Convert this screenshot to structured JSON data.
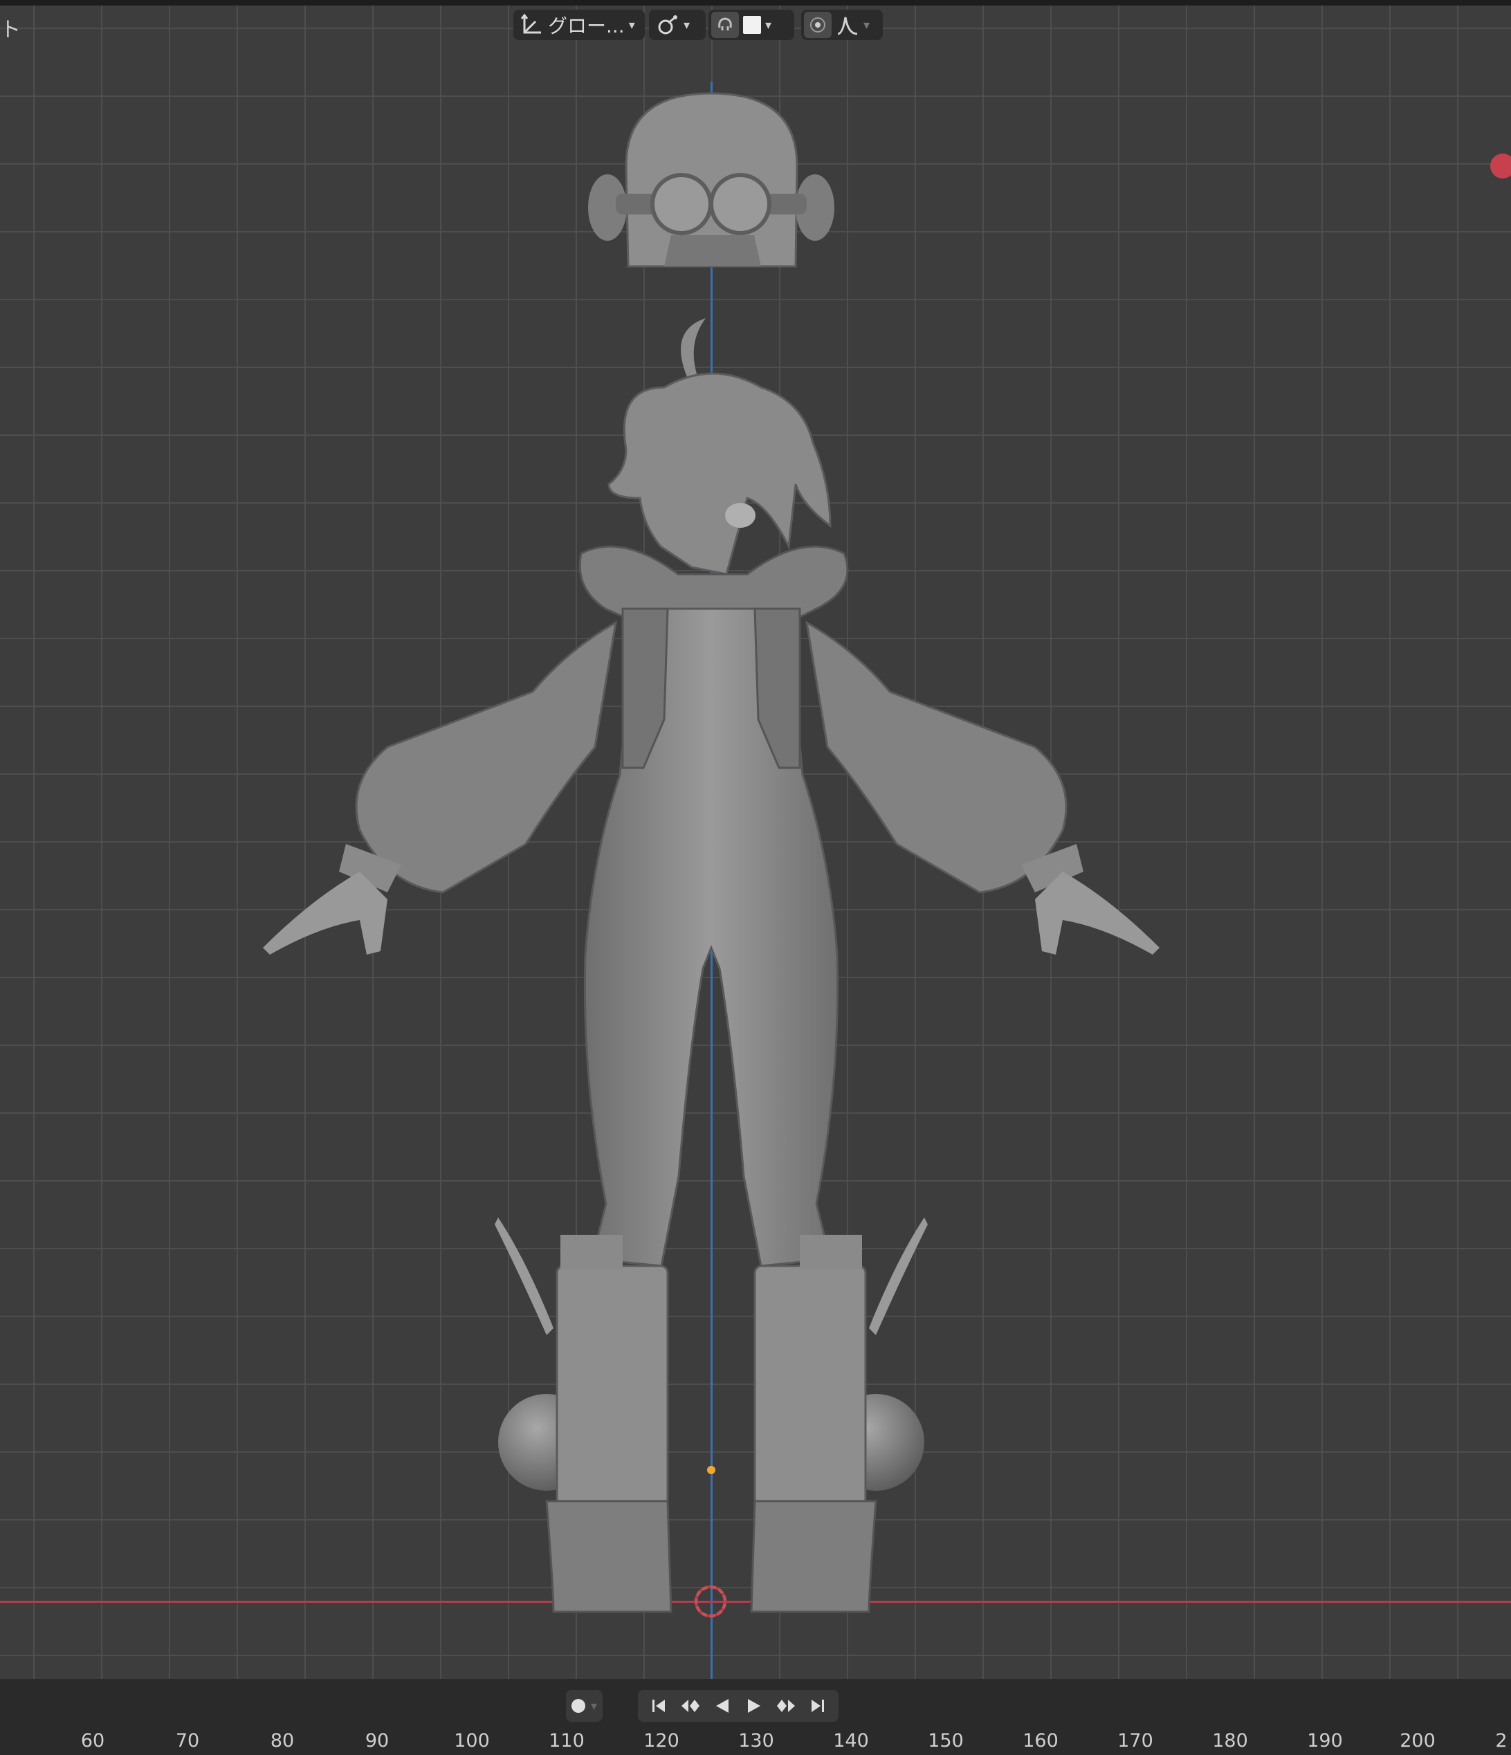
{
  "header": {
    "left_glyph": "ト",
    "orientation_label": "グロー...",
    "orientation_icon": "transform-orientation-icon",
    "pivot_icon": "pivot-point-icon",
    "snap_icon": "snap-magnet-icon",
    "snap_color": "#f2f2f2",
    "proportional_icon": "proportional-editing-icon",
    "falloff_icon": "falloff-curve-icon"
  },
  "viewport": {
    "background": "#3d3d3d",
    "grid_color": "#505050",
    "x_axis_color": "#b33d4c",
    "z_axis_color": "#3c6fae",
    "origin_color": "#f0a830"
  },
  "timeline": {
    "keyframe_icon": "record-keyframe-icon",
    "playback_icons": [
      "jump-start-icon",
      "prev-keyframe-icon",
      "play-reverse-icon",
      "play-icon",
      "next-keyframe-icon",
      "jump-end-icon"
    ],
    "frames": [
      "60",
      "70",
      "80",
      "90",
      "100",
      "110",
      "120",
      "130",
      "140",
      "150",
      "160",
      "170",
      "180",
      "190",
      "200",
      "2"
    ]
  }
}
